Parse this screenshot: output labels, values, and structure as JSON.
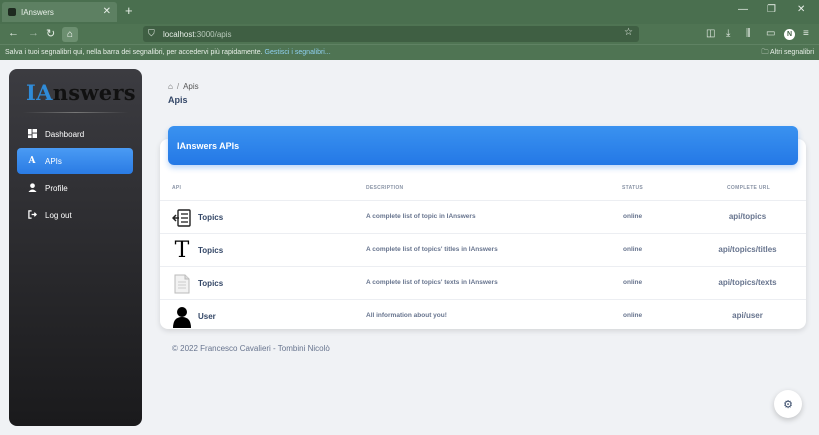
{
  "browser": {
    "tab_title": "IAnswers",
    "tab_close": "✕",
    "new_tab": "+",
    "url_host": "localhost",
    "url_path": ":3000/apis",
    "bookmarks_hint": "Salva i tuoi segnalibri qui, nella barra dei segnalibri, per accedervi più rapidamente.",
    "bookmarks_link": "Gestisci i segnalibri...",
    "other_bookmarks": "Altri segnalibri"
  },
  "sidebar": {
    "logo_ia": "IA",
    "logo_rest": "nswers",
    "items": [
      {
        "label": "Dashboard",
        "icon": "dashboard-icon"
      },
      {
        "label": "APIs",
        "icon": "api-icon"
      },
      {
        "label": "Profile",
        "icon": "user-icon"
      },
      {
        "label": "Log out",
        "icon": "logout-icon"
      }
    ]
  },
  "breadcrumb": {
    "current": "Apis"
  },
  "page": {
    "title": "Apis"
  },
  "card": {
    "title": "IAnswers APIs",
    "headers": {
      "api": "API",
      "description": "DESCRIPTION",
      "status": "STATUS",
      "url": "COMPLETE URL"
    },
    "rows": [
      {
        "name": "Topics",
        "description": "A complete list of topic in IAnswers",
        "status": "online",
        "url": "api/topics",
        "icon": "list-icon"
      },
      {
        "name": "Topics",
        "description": "A complete list of topics' titles in IAnswers",
        "status": "online",
        "url": "api/topics/titles",
        "icon": "title-icon"
      },
      {
        "name": "Topics",
        "description": "A complete list of topics' texts in IAnswers",
        "status": "online",
        "url": "api/topics/texts",
        "icon": "document-icon"
      },
      {
        "name": "User",
        "description": "All information about you!",
        "status": "online",
        "url": "api/user",
        "icon": "user-silhouette-icon"
      }
    ]
  },
  "footer": {
    "text": "© 2022 Francesco Cavalieri - Tombini Nicolò"
  },
  "colors": {
    "accent": "#2a7be4",
    "sidebar_dark": "#1a1a1c",
    "text_dark": "#344767",
    "text_muted": "#67748e"
  }
}
